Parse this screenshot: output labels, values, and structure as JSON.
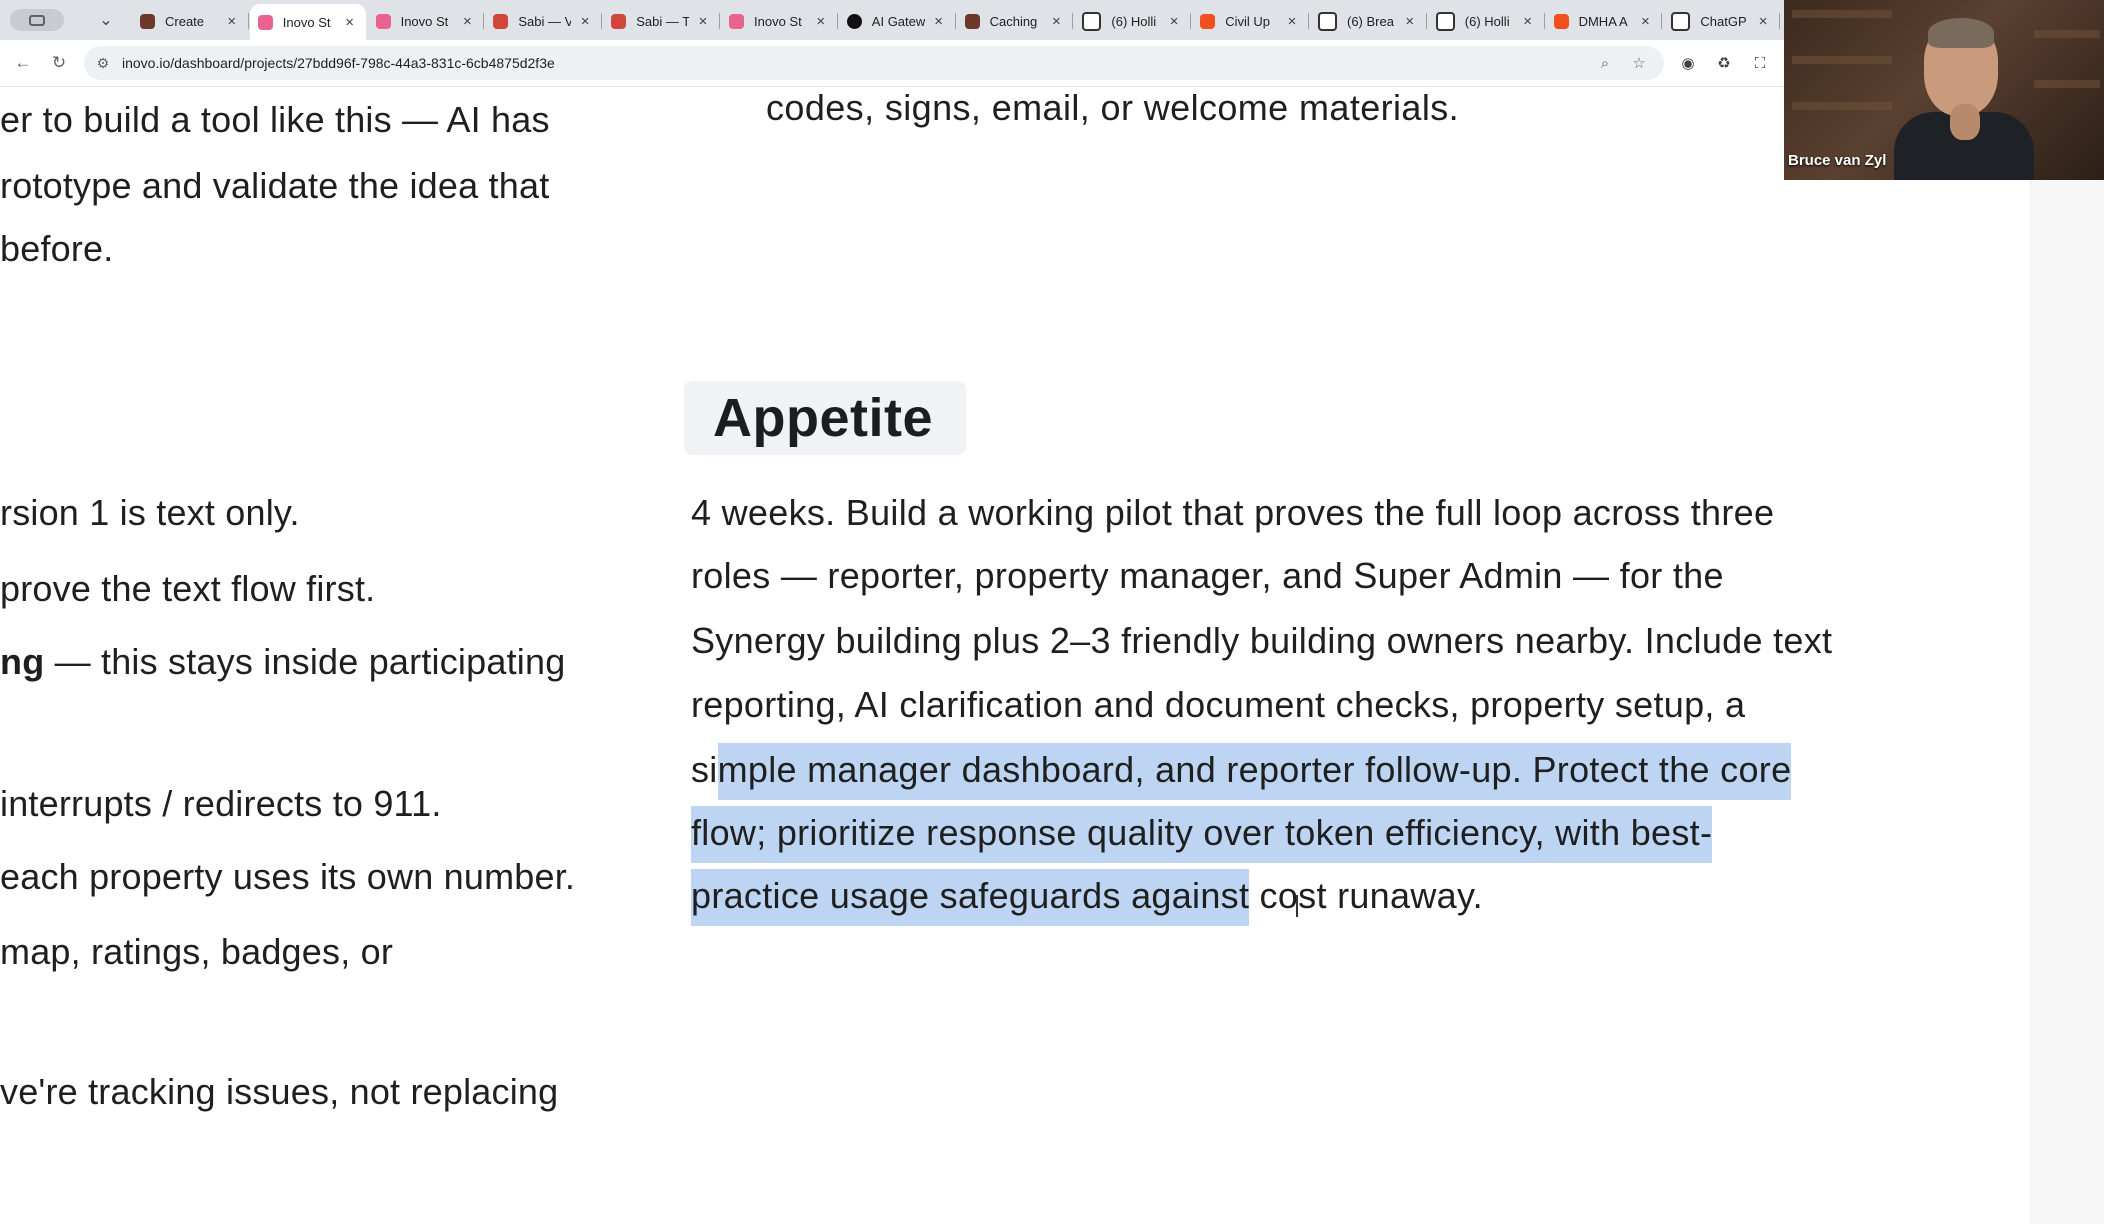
{
  "browser": {
    "tabs": [
      {
        "title": "Create",
        "icon": "app-icon",
        "active": false
      },
      {
        "title": "Inovo St",
        "icon": "inovo-icon",
        "active": true
      },
      {
        "title": "Inovo St",
        "icon": "inovo-icon",
        "active": false
      },
      {
        "title": "Sabi — V",
        "icon": "sabi-icon",
        "active": false
      },
      {
        "title": "Sabi — T",
        "icon": "sabi-icon",
        "active": false
      },
      {
        "title": "Inovo St",
        "icon": "inovo-icon",
        "active": false
      },
      {
        "title": "AI Gatew",
        "icon": "vercel-icon",
        "active": false
      },
      {
        "title": "Caching",
        "icon": "app-icon",
        "active": false
      },
      {
        "title": "(6) Holli",
        "icon": "page-icon",
        "active": false
      },
      {
        "title": "Civil Up",
        "icon": "figma-icon",
        "active": false
      },
      {
        "title": "(6) Brea",
        "icon": "notion-icon",
        "active": false
      },
      {
        "title": "(6) Holli",
        "icon": "page-icon",
        "active": false
      },
      {
        "title": "DMHA A",
        "icon": "figma-icon",
        "active": false
      },
      {
        "title": "ChatGP",
        "icon": "chatgpt-icon",
        "active": false
      }
    ],
    "url": "inovo.io/dashboard/projects/27bdd96f-798c-44a3-831c-6cb4875d2f3e"
  },
  "content": {
    "left_lines": [
      {
        "bold": "",
        "text": "er to build a tool like this — AI has"
      },
      {
        "bold": "",
        "text": "rototype and validate the idea that"
      },
      {
        "bold": "",
        "text": "before."
      },
      {
        "bold": "",
        "text": "rsion 1 is text only."
      },
      {
        "bold": "",
        "text": "prove the text flow first."
      },
      {
        "bold": "ng",
        "text": " — this stays inside participating"
      },
      {
        "bold": "",
        "text": "interrupts / redirects to 911."
      },
      {
        "bold": "",
        "text": "each property uses its own number."
      },
      {
        "bold": "",
        "text": "map, ratings, badges, or"
      },
      {
        "bold": "",
        "text": "ve're tracking issues, not replacing"
      }
    ],
    "right_top_line": "codes, signs, email, or welcome materials.",
    "heading": "Appetite",
    "paragraph_lines": [
      {
        "pre": "4 weeks. Build a working pilot that proves the full loop across three",
        "sel": "",
        "post": ""
      },
      {
        "pre": "roles — reporter, property manager, and Super Admin — for the",
        "sel": "",
        "post": ""
      },
      {
        "pre": "Synergy building plus 2–3 friendly building owners nearby. Include text",
        "sel": "",
        "post": ""
      },
      {
        "pre": "reporting, AI clarification and document checks, property setup, a",
        "sel": "",
        "post": ""
      },
      {
        "pre": "si",
        "sel": "mple manager dashboard, and reporter follow-up. Protect the core",
        "post": ""
      },
      {
        "pre": "",
        "sel": "flow; prioritize response quality over token efficiency, with best-",
        "post": ""
      },
      {
        "pre": "",
        "sel": "practice usage safeguards against",
        "post": " cost runaway."
      }
    ]
  },
  "video": {
    "participant_name": "Bruce van Zyl"
  },
  "colors": {
    "selection": "#bdd5f2",
    "heading_chip": "#f0f2f5",
    "tabstrip": "#dfe3e8"
  }
}
